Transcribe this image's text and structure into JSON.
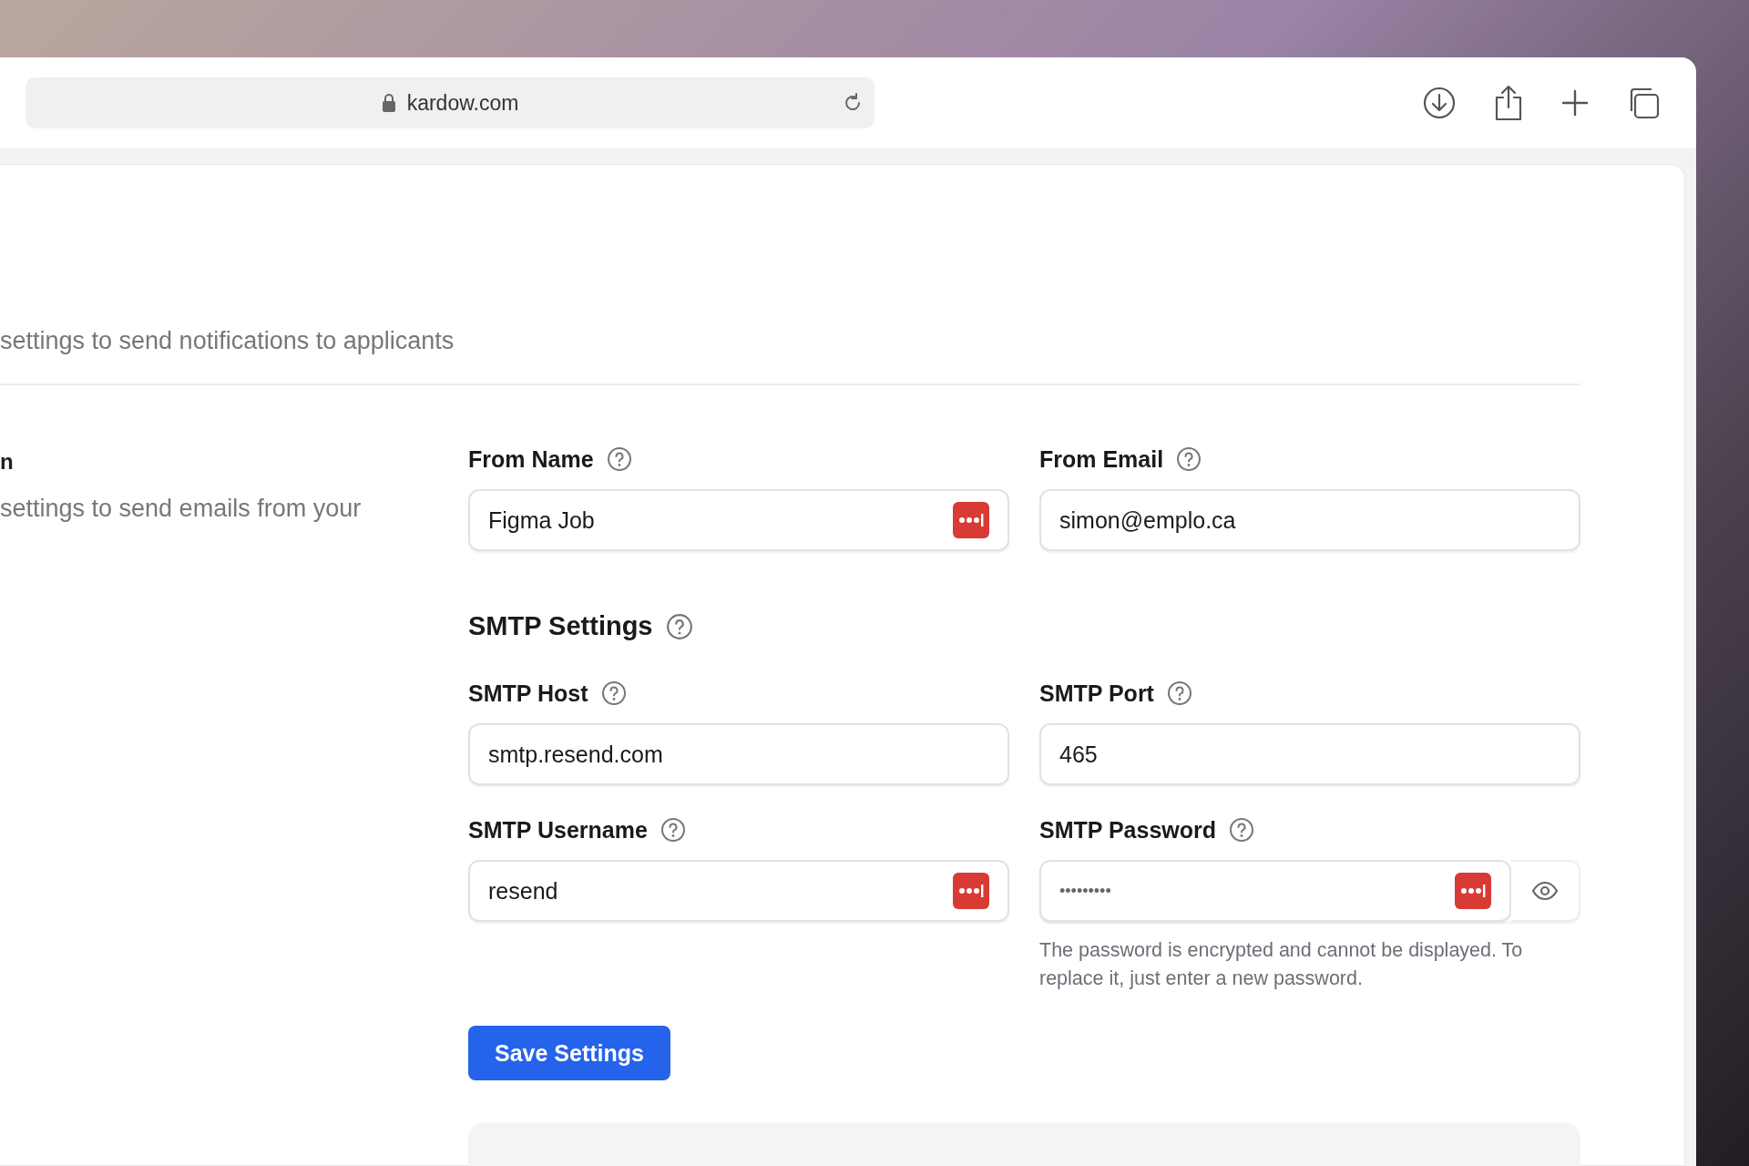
{
  "browser": {
    "url": "kardow.com"
  },
  "page": {
    "description": "settings to send notifications to applicants"
  },
  "section": {
    "title": "n",
    "description": "settings to send emails from your"
  },
  "sender_fields": [
    {
      "label": "From Name",
      "value": "Figma Job",
      "manager_icon": true
    },
    {
      "label": "From Email",
      "value": "simon@emplo.ca",
      "manager_icon": false
    }
  ],
  "smtp": {
    "title": "SMTP Settings",
    "fields": [
      {
        "kind": "text",
        "label": "SMTP Host",
        "value": "smtp.resend.com",
        "manager_icon": false
      },
      {
        "kind": "text",
        "label": "SMTP Port",
        "value": "465",
        "manager_icon": false
      },
      {
        "kind": "text",
        "label": "SMTP Username",
        "value": "resend",
        "manager_icon": true
      },
      {
        "kind": "password",
        "label": "SMTP Password",
        "value": "•••••••••",
        "manager_icon": true,
        "note": "The password is encrypted and cannot be displayed. To replace it, just enter a new password."
      }
    ]
  },
  "save_button": "Save Settings"
}
